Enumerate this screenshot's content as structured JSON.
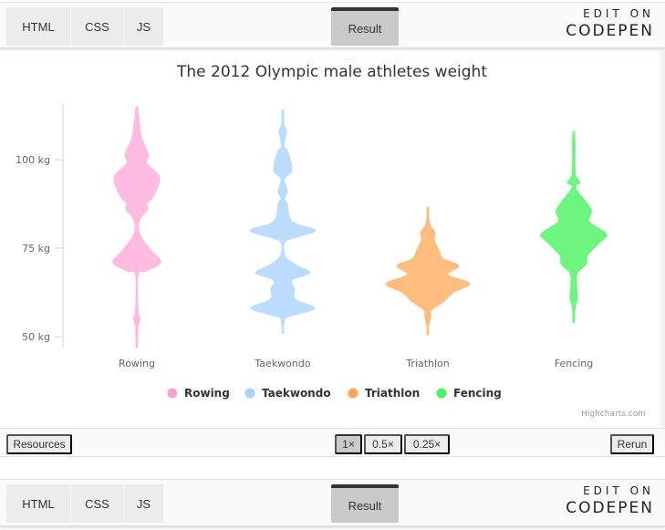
{
  "header": {
    "tabs": [
      "HTML",
      "CSS",
      "JS"
    ],
    "result_label": "Result",
    "edit_on": "EDIT ON",
    "codepen": "CODEPEN"
  },
  "footer": {
    "resources": "Resources",
    "zoom_options": [
      "1×",
      "0.5×",
      "0.25×"
    ],
    "zoom_selected": "1×",
    "rerun": "Rerun"
  },
  "chart_data": {
    "type": "violin",
    "title": "The 2012 Olympic male athletes weight",
    "credits": "Highcharts.com",
    "categories": [
      "Rowing",
      "Taekwondo",
      "Triathlon",
      "Fencing"
    ],
    "y_ticks": [
      "50 kg",
      "75 kg",
      "100 kg"
    ],
    "y_tick_values": [
      50,
      75,
      100
    ],
    "ylim": [
      46.5,
      116
    ],
    "legend_placement": "bottom",
    "density_note_units": "relative density, max = 100",
    "series": [
      {
        "name": "Rowing",
        "color": "#ffbbe0",
        "legend_color": "#f9a3cf",
        "profile": [
          [
            115,
            2
          ],
          [
            106.5,
            11
          ],
          [
            101.5,
            28
          ],
          [
            99,
            24
          ],
          [
            95,
            54
          ],
          [
            90,
            41
          ],
          [
            87.5,
            24
          ],
          [
            86,
            26
          ],
          [
            83,
            7
          ],
          [
            79,
            7
          ],
          [
            74.5,
            33
          ],
          [
            71,
            57
          ],
          [
            68.5,
            22
          ],
          [
            67.5,
            3
          ],
          [
            57.5,
            3
          ],
          [
            55,
            8
          ],
          [
            53,
            3
          ],
          [
            47,
            2
          ]
        ]
      },
      {
        "name": "Taekwondo",
        "color": "#bcdcfd",
        "legend_color": "#a9d3ff",
        "profile": [
          [
            114,
            2
          ],
          [
            110,
            3
          ],
          [
            108,
            9
          ],
          [
            104,
            3
          ],
          [
            102,
            13
          ],
          [
            97,
            22
          ],
          [
            94.5,
            4
          ],
          [
            91,
            11
          ],
          [
            89,
            4
          ],
          [
            87.5,
            11
          ],
          [
            82.5,
            22
          ],
          [
            80,
            78
          ],
          [
            78,
            30
          ],
          [
            76.5,
            4
          ],
          [
            72.5,
            7
          ],
          [
            70,
            35
          ],
          [
            68,
            65
          ],
          [
            66,
            22
          ],
          [
            63.5,
            28
          ],
          [
            60.5,
            30
          ],
          [
            58,
            76
          ],
          [
            55.5,
            11
          ],
          [
            54,
            3
          ],
          [
            51,
            2
          ]
        ]
      },
      {
        "name": "Triathlon",
        "color": "#fdbd7e",
        "legend_color": "#ffa65a",
        "profile": [
          [
            86.5,
            2
          ],
          [
            82,
            4
          ],
          [
            79.5,
            17
          ],
          [
            77.5,
            15
          ],
          [
            74.5,
            26
          ],
          [
            72,
            37
          ],
          [
            70,
            74
          ],
          [
            67.5,
            48
          ],
          [
            65,
            100
          ],
          [
            62.5,
            61
          ],
          [
            60,
            39
          ],
          [
            57.5,
            9
          ],
          [
            55.5,
            7
          ],
          [
            53,
            2
          ],
          [
            50.5,
            2
          ]
        ]
      },
      {
        "name": "Fencing",
        "color": "#6ef580",
        "legend_color": "#4cf060",
        "profile": [
          [
            108,
            2
          ],
          [
            104,
            3
          ],
          [
            96,
            4
          ],
          [
            93.5,
            15
          ],
          [
            92,
            4
          ],
          [
            86,
            41
          ],
          [
            82.5,
            37
          ],
          [
            79,
            78
          ],
          [
            76.5,
            61
          ],
          [
            73,
            33
          ],
          [
            70.5,
            30
          ],
          [
            68,
            9
          ],
          [
            64.5,
            7
          ],
          [
            61,
            9
          ],
          [
            58,
            3
          ],
          [
            54,
            2
          ]
        ]
      }
    ]
  }
}
